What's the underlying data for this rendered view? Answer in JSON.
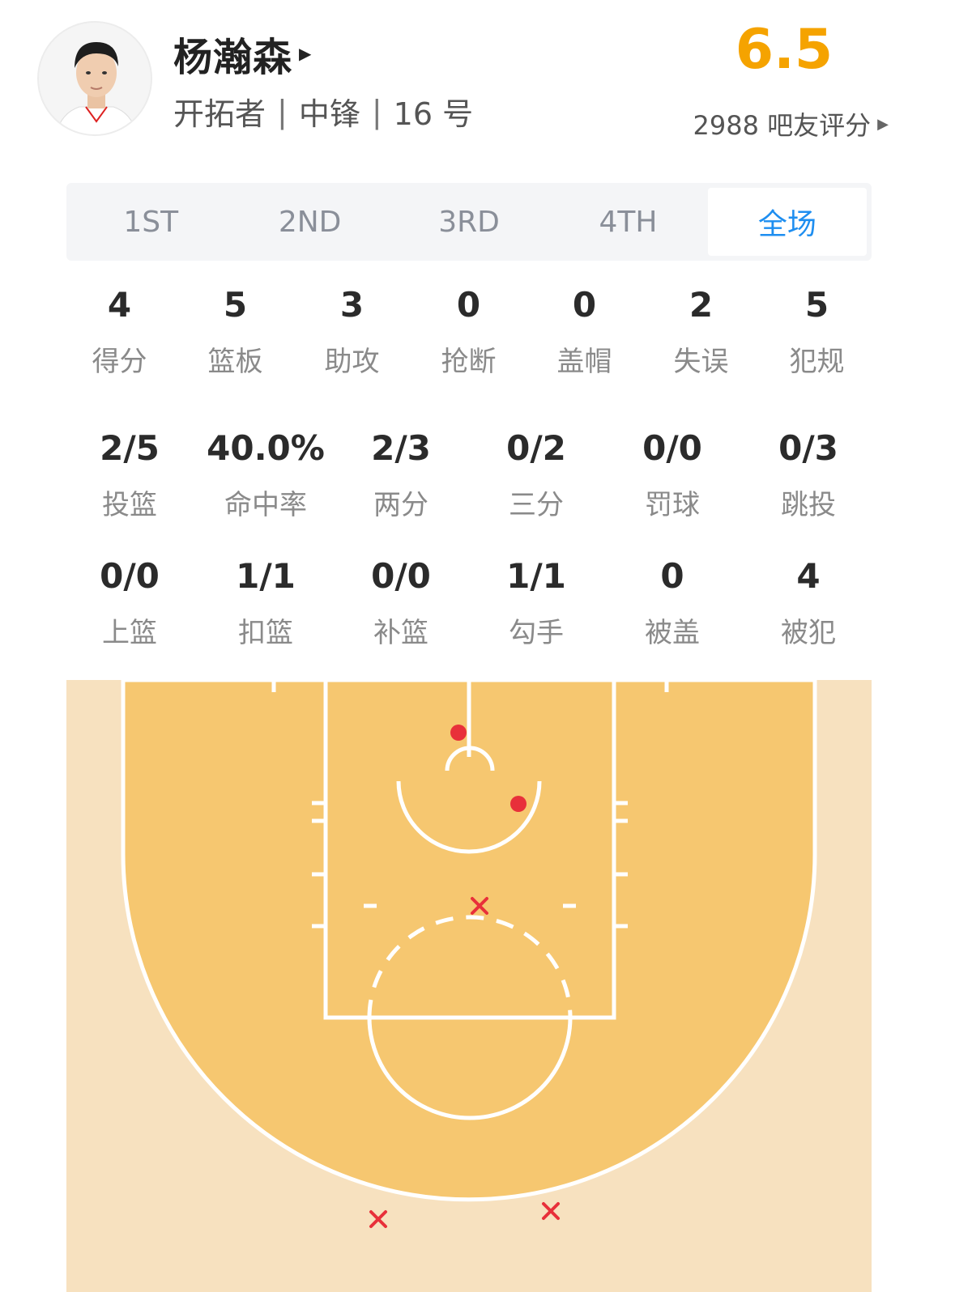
{
  "player": {
    "name": "杨瀚森",
    "team": "开拓者",
    "position": "中锋",
    "number": "16 号",
    "score": "6.5",
    "rating_count": "2988 吧友评分"
  },
  "tabs": [
    {
      "label": "1ST",
      "active": false
    },
    {
      "label": "2ND",
      "active": false
    },
    {
      "label": "3RD",
      "active": false
    },
    {
      "label": "4TH",
      "active": false
    },
    {
      "label": "全场",
      "active": true
    }
  ],
  "stats_row1": [
    {
      "value": "4",
      "label": "得分"
    },
    {
      "value": "5",
      "label": "篮板"
    },
    {
      "value": "3",
      "label": "助攻"
    },
    {
      "value": "0",
      "label": "抢断"
    },
    {
      "value": "0",
      "label": "盖帽"
    },
    {
      "value": "2",
      "label": "失误"
    },
    {
      "value": "5",
      "label": "犯规"
    }
  ],
  "stats_row2": [
    {
      "value": "2/5",
      "label": "投篮"
    },
    {
      "value": "40.0%",
      "label": "命中率"
    },
    {
      "value": "2/3",
      "label": "两分"
    },
    {
      "value": "0/2",
      "label": "三分"
    },
    {
      "value": "0/0",
      "label": "罚球"
    },
    {
      "value": "0/3",
      "label": "跳投"
    }
  ],
  "stats_row3": [
    {
      "value": "0/0",
      "label": "上篮"
    },
    {
      "value": "1/1",
      "label": "扣篮"
    },
    {
      "value": "0/0",
      "label": "补篮"
    },
    {
      "value": "1/1",
      "label": "勾手"
    },
    {
      "value": "0",
      "label": "被盖"
    },
    {
      "value": "4",
      "label": "被犯"
    }
  ],
  "colors": {
    "accent": "#1e8ef0",
    "score": "#f5a300",
    "court_inside": "#f6c770",
    "court_outside": "#f7e1bf",
    "made": "#e8303a",
    "missed": "#e8303a"
  },
  "shots": [
    {
      "result": "made"
    },
    {
      "result": "made"
    },
    {
      "result": "missed"
    },
    {
      "result": "missed"
    },
    {
      "result": "missed"
    }
  ]
}
